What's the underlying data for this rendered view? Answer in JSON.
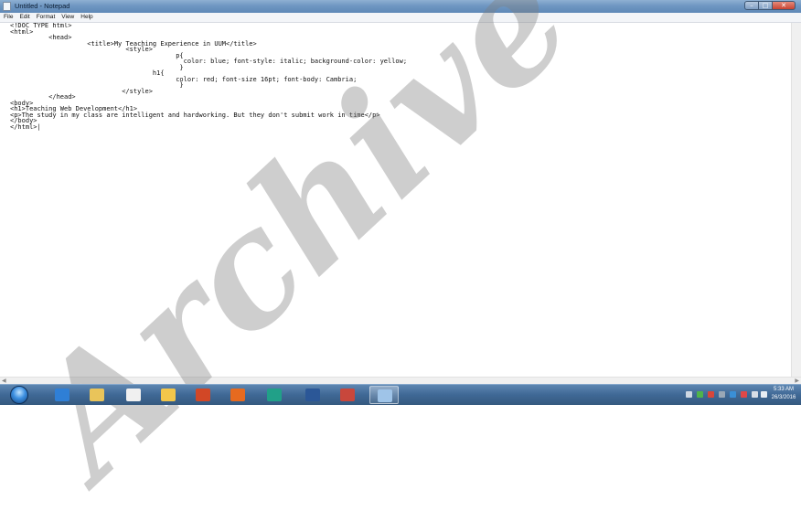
{
  "window": {
    "title": "Untitled - Notepad",
    "controls": {
      "minimize": "–",
      "maximize": "□",
      "close": "✕"
    }
  },
  "menu": [
    {
      "label": "File"
    },
    {
      "label": "Edit"
    },
    {
      "label": "Format"
    },
    {
      "label": "View"
    },
    {
      "label": "Help"
    }
  ],
  "editor": {
    "lines": [
      "<!DOC TYPE html>",
      "<html>",
      "          <head>",
      "                    <title>My Teaching Experience in UUM</title>",
      "                              <style>",
      "                                           p{",
      "                                             color: blue; font-style: italic; background-color: yellow;",
      "                                            }",
      "                                     h1{",
      "                                           color: red; font-size 16pt; font-body: Cambria;",
      "                                            }",
      "                             </style>",
      "          </head>",
      "<body>",
      "<h1>Teaching Web Development</h1>",
      "<p>The study in my class are intelligent and hardworking. But they don't submit work in time</p>",
      "</body>",
      "</html>|"
    ]
  },
  "watermark": "Archive",
  "taskbar": {
    "apps": [
      {
        "icon": "internet-explorer-icon",
        "color": "#2f7fd6"
      },
      {
        "icon": "file-explorer-icon",
        "color": "#e9c45a"
      },
      {
        "icon": "media-player-icon",
        "color": "#f0f0f0"
      },
      {
        "icon": "paint-icon",
        "color": "#f2c64a"
      },
      {
        "icon": "powerpoint-icon",
        "color": "#d24726"
      },
      {
        "icon": "firefox-icon",
        "color": "#e66a1f"
      },
      {
        "icon": "teams-icon",
        "color": "#21a088"
      },
      {
        "icon": "word-icon",
        "color": "#2b5797"
      },
      {
        "icon": "folder-window-icon",
        "color": "#c8473c"
      },
      {
        "icon": "notepad-icon",
        "color": "#9fc4e8"
      }
    ],
    "clock": {
      "time": "5:33 AM",
      "date": "26/3/2016"
    }
  }
}
